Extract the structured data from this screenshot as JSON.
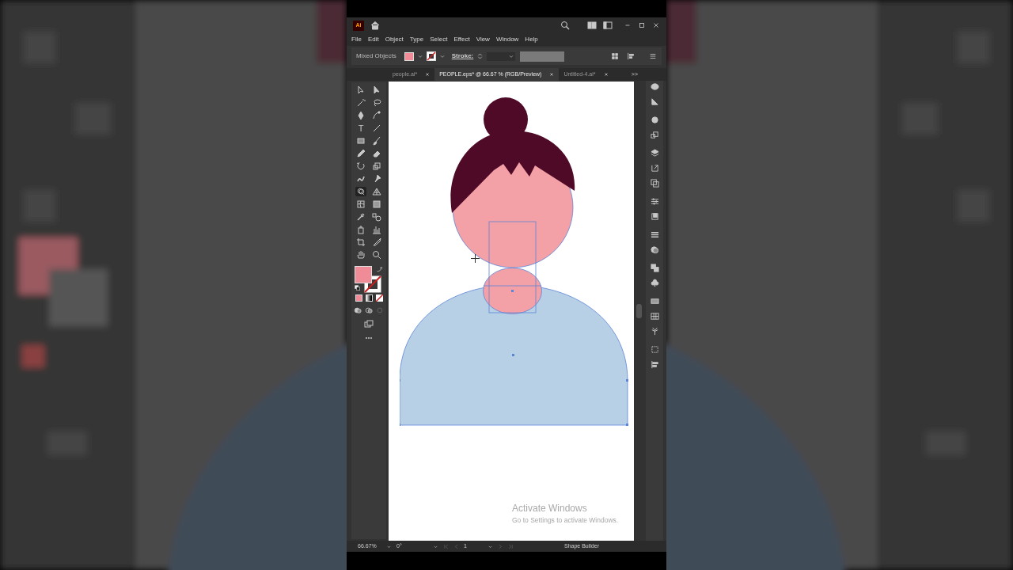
{
  "app": {
    "logo": "Ai"
  },
  "menu": [
    "File",
    "Edit",
    "Object",
    "Type",
    "Select",
    "Effect",
    "View",
    "Window",
    "Help"
  ],
  "control_bar": {
    "selection_label": "Mixed Objects",
    "stroke_label": "Stroke:"
  },
  "tabs": [
    {
      "label": "people.ai*",
      "selected": false
    },
    {
      "label": "PEOPLE.eps* @ 66.67 % (RGB/Preview)",
      "selected": true
    },
    {
      "label": "Untitled-4.ai*",
      "selected": false
    }
  ],
  "tab_overflow": ">>",
  "toolbar": {
    "type_tool": "T"
  },
  "status_bar": {
    "zoom": "66.67%",
    "rotation": "0°",
    "artboard": "1",
    "tool": "Shape Builder"
  },
  "activation_notice": {
    "title": "Activate Windows",
    "message": "Go to Settings to activate Windows."
  }
}
